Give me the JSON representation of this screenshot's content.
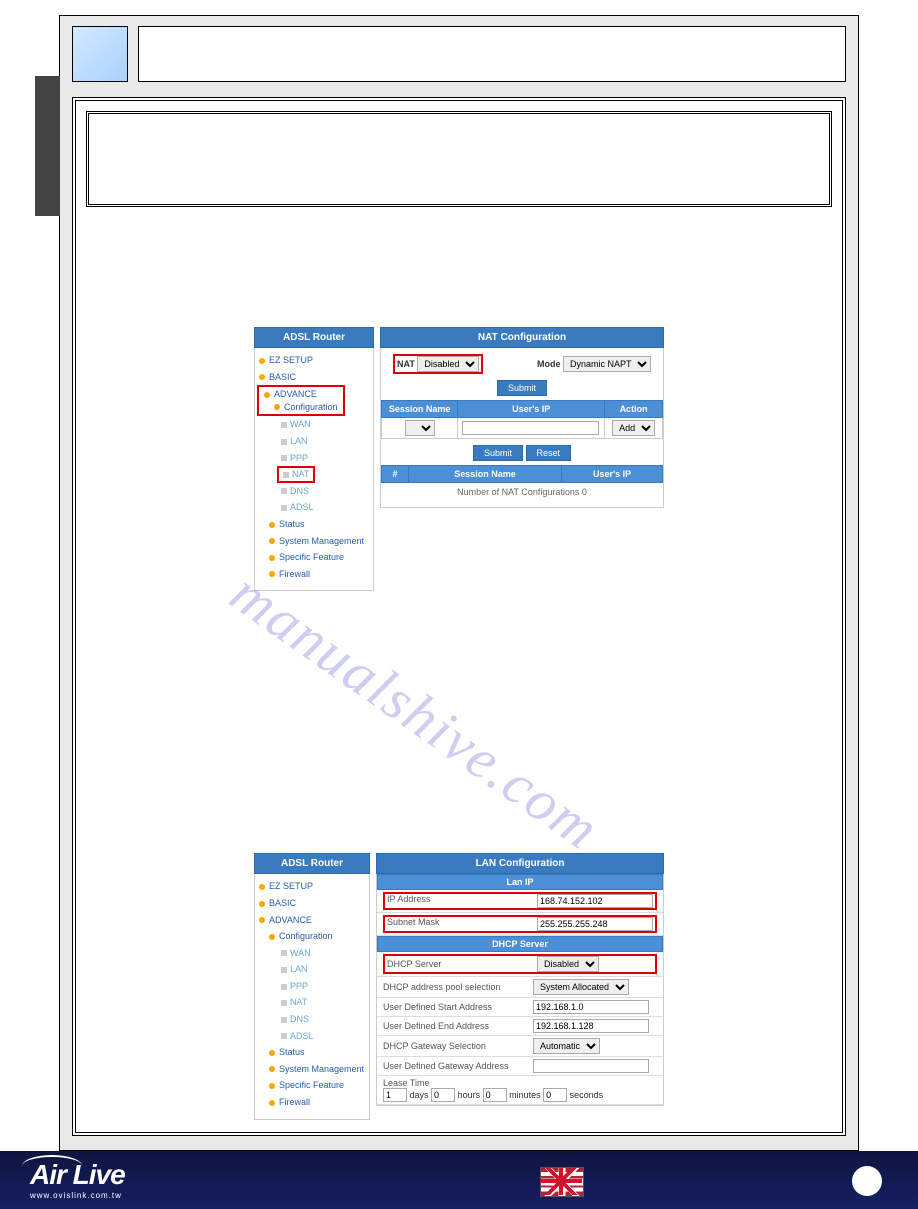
{
  "watermark": "manualshive.com",
  "screenshot1": {
    "sidebar_title": "ADSL Router",
    "main_title": "NAT Configuration",
    "nav": {
      "ez_setup": "EZ SETUP",
      "basic": "BASIC",
      "advance": "ADVANCE",
      "configuration": "Configuration",
      "wan": "WAN",
      "lan": "LAN",
      "ppp": "PPP",
      "nat": "NAT",
      "dns": "DNS",
      "adsl": "ADSL",
      "status": "Status",
      "system_management": "System Management",
      "specific_feature": "Specific Feature",
      "firewall": "Firewall"
    },
    "nat_label": "NAT",
    "nat_value": "Disabled",
    "mode_label": "Mode",
    "mode_value": "Dynamic NAPT",
    "submit": "Submit",
    "reset": "Reset",
    "columns": {
      "session_name": "Session Name",
      "users_ip": "User's IP",
      "action": "Action",
      "action_value": "Add",
      "num": "#"
    },
    "footer_note": "Number of NAT Configurations 0"
  },
  "screenshot2": {
    "sidebar_title": "ADSL Router",
    "main_title": "LAN Configuration",
    "nav": {
      "ez_setup": "EZ SETUP",
      "basic": "BASIC",
      "advance": "ADVANCE",
      "configuration": "Configuration",
      "wan": "WAN",
      "lan": "LAN",
      "ppp": "PPP",
      "nat": "NAT",
      "dns": "DNS",
      "adsl": "ADSL",
      "status": "Status",
      "system_management": "System Management",
      "specific_feature": "Specific Feature",
      "firewall": "Firewall"
    },
    "section_lanip": "Lan IP",
    "section_dhcp": "DHCP Server",
    "fields": {
      "ip_address_label": "IP Address",
      "ip_address_value": "168.74.152.102",
      "subnet_label": "Subnet Mask",
      "subnet_value": "255.255.255.248",
      "dhcp_server_label": "DHCP Server",
      "dhcp_server_value": "Disabled",
      "pool_label": "DHCP address pool selection",
      "pool_value": "System Allocated",
      "start_label": "User Defined Start Address",
      "start_value": "192.168.1.0",
      "end_label": "User Defined End Address",
      "end_value": "192.168.1.128",
      "gateway_sel_label": "DHCP Gateway Selection",
      "gateway_sel_value": "Automatic",
      "user_gw_label": "User Defined Gateway Address",
      "user_gw_value": "",
      "lease_label": "Lease Time",
      "lease_days": "1",
      "lease_days_unit": "days",
      "lease_hours": "0",
      "lease_hours_unit": "hours",
      "lease_minutes": "0",
      "lease_minutes_unit": "minutes",
      "lease_seconds": "0",
      "lease_seconds_unit": "seconds"
    }
  },
  "footer": {
    "brand": "Air Live",
    "url": "www.ovislink.com.tw"
  }
}
